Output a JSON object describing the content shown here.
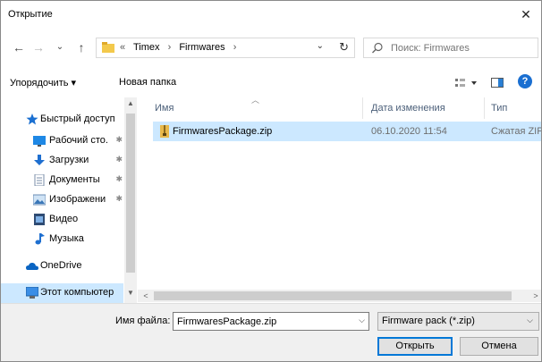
{
  "window": {
    "title": "Открытие",
    "close_glyph": "✕"
  },
  "nav": {
    "back": "←",
    "forward": "→",
    "recent": "⌄",
    "up": "↑"
  },
  "address": {
    "overflow": "«",
    "crumbs": [
      "Timex",
      "Firmwares"
    ],
    "separator": "›",
    "dropdown": "⌄",
    "refresh": "↻"
  },
  "search": {
    "placeholder": "Поиск: Firmwares",
    "icon": "magnifier-icon"
  },
  "toolbar": {
    "organize": "Упорядочить ▾",
    "new_folder": "Новая папка",
    "view_icon": "view-options-icon",
    "preview_icon": "preview-pane-icon",
    "help": "?"
  },
  "sidebar": {
    "items": [
      {
        "label": "Быстрый доступ",
        "icon": "star-icon",
        "pinned": false
      },
      {
        "label": "Рабочий сто.",
        "icon": "desktop-icon",
        "pinned": true
      },
      {
        "label": "Загрузки",
        "icon": "download-icon",
        "pinned": true
      },
      {
        "label": "Документы",
        "icon": "documents-icon",
        "pinned": true
      },
      {
        "label": "Изображени",
        "icon": "pictures-icon",
        "pinned": true
      },
      {
        "label": "Видео",
        "icon": "video-icon",
        "pinned": false
      },
      {
        "label": "Музыка",
        "icon": "music-icon",
        "pinned": false
      },
      {
        "label": "OneDrive",
        "icon": "cloud-icon",
        "pinned": false
      },
      {
        "label": "Этот компьютер",
        "icon": "computer-icon",
        "pinned": false
      }
    ],
    "pin_glyph": "📌"
  },
  "list": {
    "columns": {
      "name": "Имя",
      "date": "Дата изменения",
      "type": "Тип"
    },
    "rows": [
      {
        "name": "FirmwaresPackage.zip",
        "date": "06.10.2020 11:54",
        "type": "Сжатая ZIP-"
      }
    ]
  },
  "footer": {
    "filename_label": "Имя файла:",
    "filename_value": "FirmwaresPackage.zip",
    "filetype": "Firmware pack (*.zip)",
    "open": "Открыть",
    "cancel": "Отмена"
  },
  "colors": {
    "selection": "#cce8ff",
    "accent": "#0078d7",
    "zip": "#e8b84a",
    "folder": "#f3c94c",
    "star": "#1a6fd1"
  }
}
